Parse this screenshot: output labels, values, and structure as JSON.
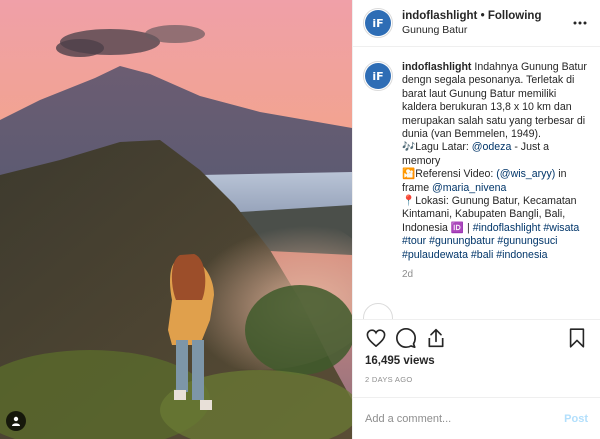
{
  "header": {
    "avatar_text": "iF",
    "username": "indoflashlight",
    "separator": "•",
    "follow_status": "Following",
    "location": "Gunung Batur"
  },
  "caption": {
    "username": "indoflashlight",
    "line1": "Indahnya Gunung Batur dengn segala pesonanya. Terletak di barat laut Gunung Batur memiliki kaldera berukuran 13,8 x 10 km dan merupakan salah satu yang terbesar di dunia (van Bemmelen, 1949).",
    "music_icon": "🎶",
    "music_label": "Lagu Latar: ",
    "music_mention": "@odeza",
    "music_rest": " - Just a memory",
    "ref_icon": "🎦",
    "ref_label": "Referensi Video: ",
    "ref_mention": "(@wis_aryy)",
    "ref_mid": " in frame ",
    "ref_mention2": "@maria_nivena",
    "loc_icon": "📍",
    "loc_text": "Lokasi: Gunung Batur, Kecamatan Kintamani, Kabupaten Bangli, Bali, Indonesia 🆔 | ",
    "hashtags": "#indoflashlight #wisata #tour #gunungbatur #gunungsuci #pulaudewata #bali #indonesia",
    "hashtag_first": "#indoflashlight",
    "hashtag_rest": "#wisata #tour #gunungbatur #gunungsuci #pulaudewata #bali #indonesia",
    "time": "2d"
  },
  "stats": {
    "views": "16,495 views",
    "date": "2 DAYS AGO"
  },
  "comment_box": {
    "placeholder": "Add a comment...",
    "post_label": "Post"
  },
  "colors": {
    "link": "#003569",
    "post_disabled": "#b2dffc",
    "muted": "#8e8e8e"
  },
  "icons": [
    "more-options-icon",
    "heart-icon",
    "comment-icon",
    "share-icon",
    "bookmark-icon",
    "user-tag-icon"
  ]
}
